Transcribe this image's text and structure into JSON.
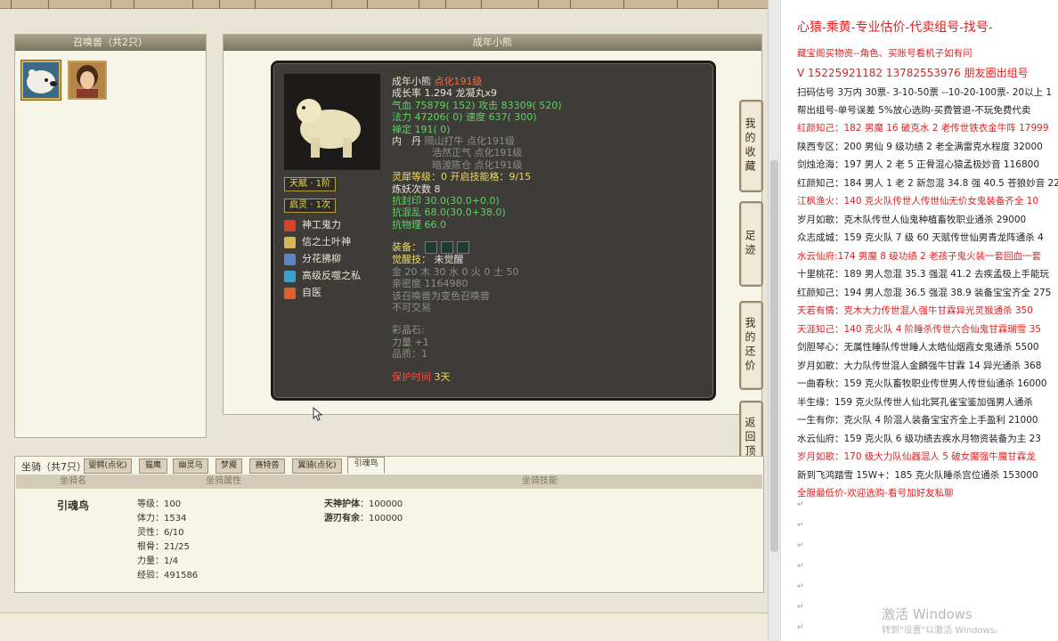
{
  "summon_panel": {
    "title": "召唤兽（共2只）"
  },
  "detail_panel": {
    "title": "成年小熊"
  },
  "pet": {
    "name": "成年小熊",
    "name_tag": "点化191级",
    "growth": "成长率 1.294 龙凝丸x9",
    "hp_label": "气血",
    "hp_val": "75879",
    "hp_bonus": "( 152)",
    "atk_label": "攻击",
    "atk_val": "83309",
    "atk_bonus": "( 520)",
    "mp_label": "法力",
    "mp_val": "47206",
    "mp_bonus": "( 0)",
    "spd_label": "速度",
    "spd_val": "637",
    "spd_bonus": "( 300)",
    "zen_label": "禅定",
    "zen_val": "191",
    "zen_bonus": "( 0)",
    "neidan_label": "内　丹",
    "neidan": [
      {
        "name": "隔山打牛",
        "lv": "点化191级"
      },
      {
        "name": "浩然正气",
        "lv": "点化191级"
      },
      {
        "name": "暗渡陈仓",
        "lv": "点化191级"
      }
    ],
    "spirit": "灵犀等级：0 开启技能格：9/15",
    "refine": "炼妖次数 8",
    "res1": "抗封印 30.0(30.0+0.0)",
    "res2": "抗混乱 68.0(30.0+38.0)",
    "res3": "抗物理 66.0",
    "equip_label": "装备：",
    "awaken_label": "觉醒技：",
    "awaken_val": "未觉醒",
    "elements": "金 20 木 30 水 0 火 0 土 50",
    "intimacy": "亲密度 1164980",
    "note1": "该召唤兽为变色召唤兽",
    "note2": "不可交易",
    "gem_label": "彩晶石:",
    "gem1": "力量 +1",
    "gem2": "品质：1",
    "protect_label": "保护时间",
    "protect_val": "3天"
  },
  "talent_tags": [
    "天赋 · 1阶",
    "启灵 · 1次"
  ],
  "skills": [
    "神工鬼力",
    "信之土叶神",
    "分花拂柳",
    "高级反噬之私",
    "自医"
  ],
  "side_tabs": [
    "我的收藏",
    "足迹",
    "我的还价",
    "返回顶部"
  ],
  "mount_tabs": {
    "count": "坐骑（共7只）",
    "items": [
      "婴鳄(点化)",
      "猫鹰",
      "幽灵马",
      "梦魇",
      "赛特兽",
      "翼骑(点化)",
      "引魂鸟"
    ]
  },
  "mount_cols": [
    "坐骑名",
    "坐骑属性",
    "坐骑技能"
  ],
  "mount": {
    "name": "引魂鸟",
    "attrs": [
      "等级：100",
      "体力：1534",
      "灵性：6/10",
      "根骨：21/25",
      "力量：1/4",
      "经验：491586"
    ],
    "skills": [
      {
        "name": "天神护体",
        "val": "100000"
      },
      {
        "name": "游刃有余",
        "val": "100000"
      }
    ]
  },
  "ad": {
    "header": "心猿-乘黄-专业估价-代卖组号-找号-",
    "line1": "藏宝阁买物资--角色、买账号看机子如有问",
    "line2": "V 15225921182 13782553976 朋友圈出组号",
    "line3": "扫码估号 3万内 30票- 3-10-50票 --10-20-100票- 20以上 1",
    "line4": "帮出组号-单号误差 5%放心选购-买费管退-不玩免费代卖",
    "listings": [
      {
        "t": "红颜知己：182 男魔 16 破克水 2 老传世铁衣金牛阵 17999",
        "red": true
      },
      {
        "t": "陕西专区：200 男仙 9 级功绩 2 老全满雷克水程度 32000",
        "red": false
      },
      {
        "t": "剑烛沧海：197 男人 2 老 5 正骨混心猿孟极妙音 116800",
        "red": false
      },
      {
        "t": "红颜知己：184 男人 1 老 2 新忽混 34.8 强 40.5 苍狼妙音 22",
        "red": false
      },
      {
        "t": "江枫渔火：140 克火队传世人传世仙无价女鬼装备齐全 10",
        "red": true
      },
      {
        "t": "岁月如歌：克木队传世人仙鬼种植畜牧职业通杀 29000",
        "red": false
      },
      {
        "t": "众志成城：159 克火队 7 级 60 天赋传世仙男青龙阵通杀 4",
        "red": false
      },
      {
        "t": "水云仙府:174 男魔 8 级功绩 2 老孩子鬼火装一套回血一套",
        "red": true
      },
      {
        "t": "十里桃花：189 男人忽混 35.3 强混 41.2 去疾孟极上手能玩",
        "red": false
      },
      {
        "t": "红颜知己：194 男人忽混 36.5 强混 38.9 装备宝宝齐全 275",
        "red": false
      },
      {
        "t": "天若有情：克木大力传世混人强牛甘霖异光灵猴通杀 350",
        "red": true
      },
      {
        "t": "天涯知己：140 克火队 4 阶睡杀传世六合仙鬼甘霖瑞雪 35",
        "red": true
      },
      {
        "t": "剑胆琴心：无属性睡队传世睡人太皓仙烟霞女鬼通杀 5500",
        "red": false
      },
      {
        "t": "岁月如歌：大力队传世混人金麟强牛甘霖 14 异光通杀 368",
        "red": false
      },
      {
        "t": "一曲春秋：159 克火队畜牧职业传世男人传世仙通杀 16000",
        "red": false
      },
      {
        "t": "半生缘：159 克火队传世人仙北冥孔雀宝鉴加强男人通杀",
        "red": false
      },
      {
        "t": "一生有你：克火队 4 阶混人装备宝宝齐全上手盈利 21000",
        "red": false
      },
      {
        "t": "水云仙府：159 克火队 6 级功绩去疾水月物资装备为主 23",
        "red": false
      },
      {
        "t": "岁月如歌：170 级大力队仙器混人 5 破女魔强牛魔甘霖龙",
        "red": true
      },
      {
        "t": "新到飞鸿踏雪 15W+：185 克火队睡杀宫位通杀 153000",
        "red": false
      },
      {
        "t": "全服最低价-欢迎选购-看号加好友私聊",
        "red": true
      }
    ]
  },
  "watermark": {
    "title": "激活 Windows",
    "sub": "转到\"设置\"以激活 Windows。"
  }
}
